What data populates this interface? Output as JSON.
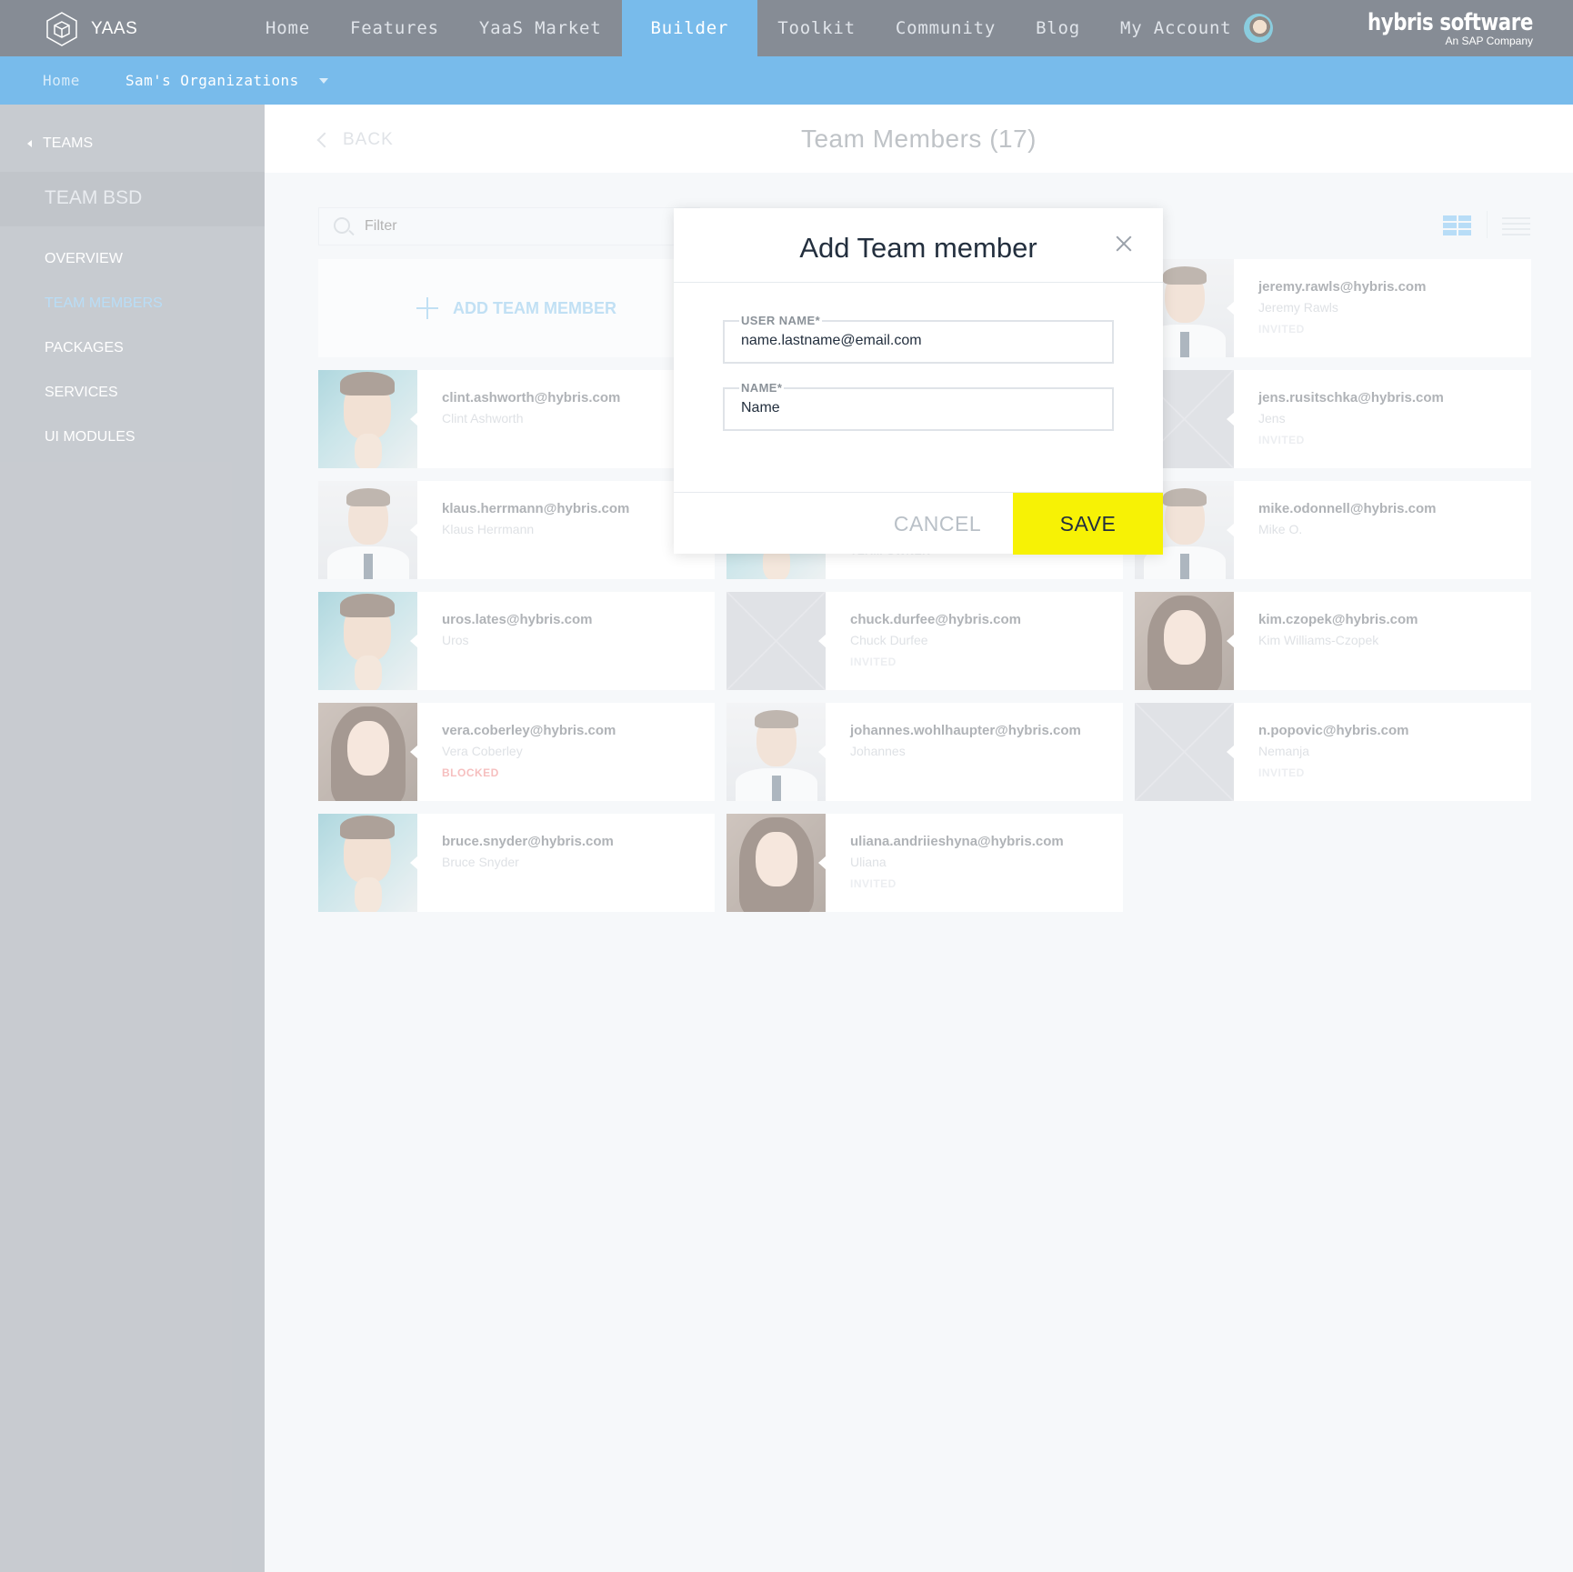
{
  "app": {
    "logo_text": "YAAS",
    "brand_name": "hybris software",
    "brand_sub": "An SAP Company"
  },
  "nav": {
    "items": [
      {
        "label": "Home"
      },
      {
        "label": "Features"
      },
      {
        "label": "YaaS Market"
      },
      {
        "label": "Builder",
        "active": true
      },
      {
        "label": "Toolkit"
      },
      {
        "label": "Community"
      },
      {
        "label": "Blog"
      },
      {
        "label": "My Account"
      }
    ]
  },
  "subnav": {
    "home": "Home",
    "org": "Sam's Organizations"
  },
  "sidebar": {
    "teams": "TEAMS",
    "team_name": "TEAM BSD",
    "items": [
      {
        "label": "OVERVIEW"
      },
      {
        "label": "TEAM MEMBERS",
        "active": true
      },
      {
        "label": "PACKAGES"
      },
      {
        "label": "SERVICES"
      },
      {
        "label": "UI MODULES"
      }
    ]
  },
  "header": {
    "back": "BACK",
    "title": "Team Members (17)"
  },
  "filter": {
    "placeholder": "Filter"
  },
  "add_member": {
    "label": "ADD TEAM MEMBER"
  },
  "members": [
    {
      "email": "jeremy.rawls@hybris.com",
      "name": "Jeremy Rawls",
      "status": "INVITED"
    },
    {
      "email": "clint.ashworth@hybris.com",
      "name": "Clint Ashworth",
      "status": ""
    },
    {
      "email": "jens.rusitschka@hybris.com",
      "name": "Jens",
      "status": "INVITED"
    },
    {
      "email": "klaus.herrmann@hybris.com",
      "name": "Klaus Herrmann",
      "status": ""
    },
    {
      "email": "",
      "name": "",
      "status": "TEAM OWNER"
    },
    {
      "email": "mike.odonnell@hybris.com",
      "name": "Mike O.",
      "status": ""
    },
    {
      "email": "uros.lates@hybris.com",
      "name": "Uros",
      "status": ""
    },
    {
      "email": "chuck.durfee@hybris.com",
      "name": "Chuck Durfee",
      "status": "INVITED"
    },
    {
      "email": "kim.czopek@hybris.com",
      "name": "Kim Williams-Czopek",
      "status": ""
    },
    {
      "email": "vera.coberley@hybris.com",
      "name": "Vera Coberley",
      "status": "BLOCKED"
    },
    {
      "email": "johannes.wohlhaupter@hybris.com",
      "name": "Johannes",
      "status": ""
    },
    {
      "email": "n.popovic@hybris.com",
      "name": "Nemanja",
      "status": "INVITED"
    },
    {
      "email": "bruce.snyder@hybris.com",
      "name": "Bruce Snyder",
      "status": ""
    },
    {
      "email": "uliana.andriieshyna@hybris.com",
      "name": "Uliana",
      "status": "INVITED"
    }
  ],
  "modal": {
    "title": "Add Team member",
    "username_label": "USER NAME*",
    "username_value": "name.lastname@email.com",
    "name_label": "NAME*",
    "name_value": "Name",
    "cancel": "CANCEL",
    "save": "SAVE"
  },
  "colors": {
    "nav_bg": "#232f3e",
    "accent": "#0a84db",
    "save_yellow": "#f7f205",
    "blocked": "#ef8a8a"
  }
}
